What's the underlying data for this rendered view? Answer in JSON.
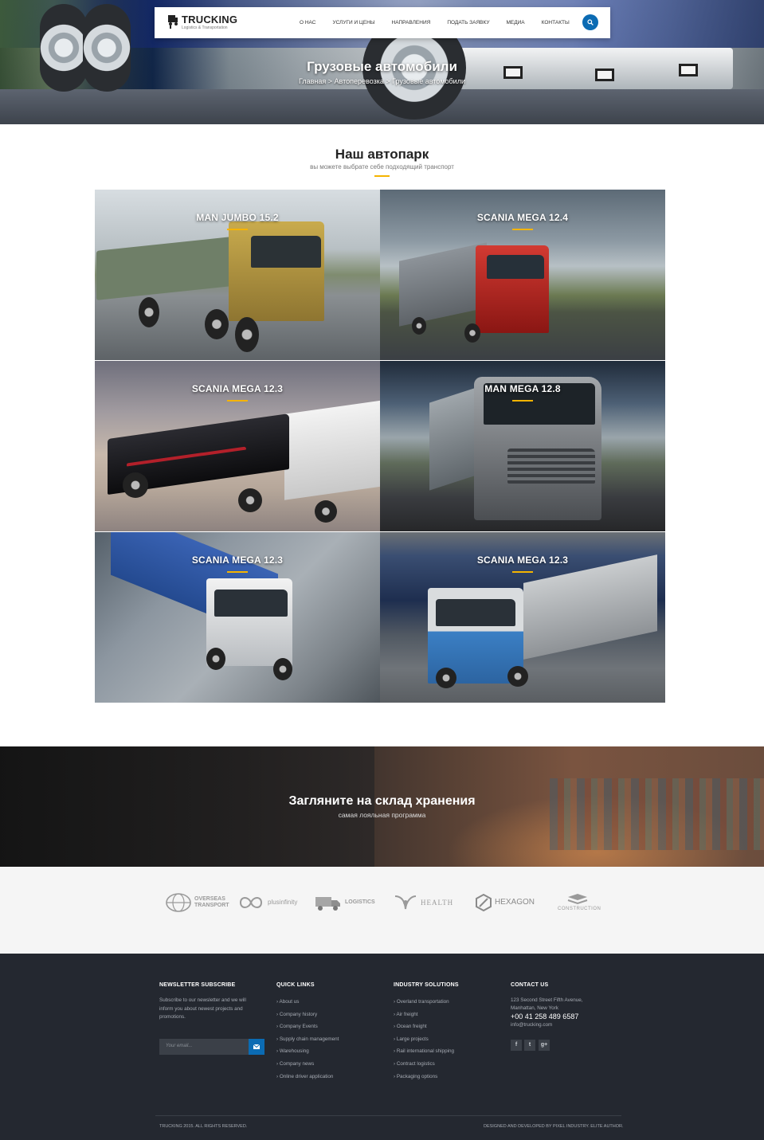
{
  "header": {
    "logo_title": "TRUCKING",
    "logo_subtitle": "Logistics & Transportation",
    "nav": [
      "О НАС",
      "УСЛУГИ И ЦЕНЫ",
      "НАПРАВЛЕНИЯ",
      "ПОДАТЬ ЗАЯВКУ",
      "МЕДИА",
      "КОНТАКТЫ"
    ],
    "search_icon": "search-icon",
    "accent": "#0b6bb3"
  },
  "hero": {
    "title": "Грузовые автомобили",
    "breadcrumb": "Главная > Автоперевозка > Грузовые автомобили"
  },
  "fleet": {
    "title": "Наш автопарк",
    "subtitle": "вы можете выбрате себе подходящий транспорт",
    "underline_color": "#f5b400",
    "cards": [
      {
        "name": "MAN JUMBO 15.2",
        "truck_color": "#b99a3c"
      },
      {
        "name": "SCANIA MEGA 12.4",
        "truck_color": "#c8231f"
      },
      {
        "name": "SCANIA MEGA 12.3",
        "truck_color": "#1b1b1e"
      },
      {
        "name": "MAN MEGA 12.8",
        "truck_color": "#7d8084"
      },
      {
        "name": "SCANIA MEGA 12.3",
        "truck_color": "#e8e8e8"
      },
      {
        "name": "SCANIA MEGA 12.3",
        "truck_color": "#3b7fc4"
      }
    ]
  },
  "warehouse": {
    "title": "Загляните на склад хранения",
    "subtitle": "самая лояльная программа"
  },
  "partners": [
    {
      "label": "OVERSEAS TRANSPORT",
      "icon": "globe-icon"
    },
    {
      "label": "plusinfinity",
      "icon": "infinity-icon"
    },
    {
      "label": "LOGISTICS",
      "icon": "truck-icon"
    },
    {
      "label": "HEALTH",
      "icon": "leaf-icon"
    },
    {
      "label": "HEXAGON",
      "icon": "hexagon-icon"
    },
    {
      "label": "CONSTRUCTION",
      "icon": "layers-icon"
    }
  ],
  "footer": {
    "newsletter": {
      "heading": "NEWSLETTER SUBSCRIBE",
      "text": "Subscribe to our newsletter and we will inform you about newest projects and promotions.",
      "placeholder": "Your email..."
    },
    "quick_links": {
      "heading": "QUICK LINKS",
      "items": [
        "About us",
        "Company history",
        "Company Events",
        "Supply chain management",
        "Warehousing",
        "Company news",
        "Online driver application"
      ]
    },
    "industry": {
      "heading": "INDUSTRY SOLUTIONS",
      "items": [
        "Overland transportation",
        "Air freight",
        "Ocean freight",
        "Large projects",
        "Rail international shipping",
        "Contract logistics",
        "Packaging options"
      ]
    },
    "contact": {
      "heading": "CONTACT US",
      "address1": "123 Second Street Fifth Avenue,",
      "address2": "Manhattan, New York",
      "phone": "+00 41 258 489 6587",
      "email": "info@trucking.com",
      "social": [
        "f",
        "t",
        "g+"
      ]
    },
    "copyright": "TRUCKING 2015. ALL RIGHTS RESERVED.",
    "credits": "DESIGNED AND DEVELOPED BY PIXEL INDUSTRY. ELITE AUTHOR."
  }
}
